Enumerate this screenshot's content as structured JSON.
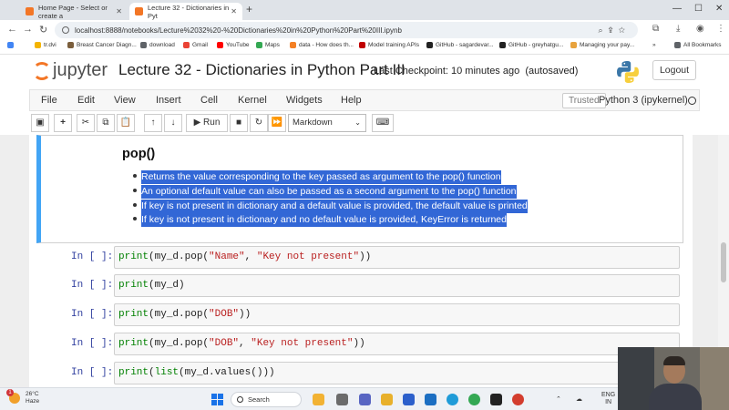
{
  "browser": {
    "tabs": [
      {
        "label": "Home Page - Select or create a",
        "active": false
      },
      {
        "label": "Lecture 32 - Dictionaries in Pyt",
        "active": true
      }
    ],
    "new_tab": "+",
    "url": "localhost:8888/notebooks/Lecture%2032%20-%20Dictionaries%20in%20Python%20Part%20III.ipynb",
    "bookmarks": [
      "tr.dvi",
      "Breast Cancer Diagn...",
      "download",
      "Gmail",
      "YouTube",
      "Maps",
      "data - How does th...",
      "Model training APIs",
      "GitHub - sagardevar...",
      "GitHub - greyhatgu...",
      "Managing your pay...",
      "»",
      "All Bookmarks"
    ]
  },
  "jupyter": {
    "logo_text": "jupyter",
    "notebook_title": "Lecture 32 - Dictionaries in Python Part III",
    "checkpoint_label": "Last Checkpoint:",
    "checkpoint_time": "10 minutes ago",
    "autosave": "(autosaved)",
    "logout": "Logout",
    "menus": [
      "File",
      "Edit",
      "View",
      "Insert",
      "Cell",
      "Kernel",
      "Widgets",
      "Help"
    ],
    "trusted": "Trusted",
    "kernel_name": "Python 3 (ipykernel)",
    "toolbar": {
      "run_label": "Run",
      "cell_type": "Markdown"
    }
  },
  "markdown_cell": {
    "heading": "pop()",
    "items": [
      "Returns the value corresponding to the key passed as argument to the pop() function",
      "An optional default value can also be passed as a second argument to the pop() function",
      "If key is not present in dictionary and a default value is provided, the default value is printed",
      "If key is not present in dictionary and no default value is provided, KeyError is returned"
    ]
  },
  "code_cells": [
    {
      "prompt": "In [ ]:",
      "parts": [
        {
          "t": "print",
          "k": "fn"
        },
        {
          "t": "(my_d.pop(",
          "k": ""
        },
        {
          "t": "\"Name\"",
          "k": "st"
        },
        {
          "t": ", ",
          "k": ""
        },
        {
          "t": "\"Key not present\"",
          "k": "st"
        },
        {
          "t": "))",
          "k": ""
        }
      ]
    },
    {
      "prompt": "In [ ]:",
      "parts": [
        {
          "t": "print",
          "k": "fn"
        },
        {
          "t": "(my_d)",
          "k": ""
        }
      ]
    },
    {
      "prompt": "In [ ]:",
      "parts": [
        {
          "t": "print",
          "k": "fn"
        },
        {
          "t": "(my_d.pop(",
          "k": ""
        },
        {
          "t": "\"DOB\"",
          "k": "st"
        },
        {
          "t": "))",
          "k": ""
        }
      ]
    },
    {
      "prompt": "In [ ]:",
      "parts": [
        {
          "t": "print",
          "k": "fn"
        },
        {
          "t": "(my_d.pop(",
          "k": ""
        },
        {
          "t": "\"DOB\"",
          "k": "st"
        },
        {
          "t": ", ",
          "k": ""
        },
        {
          "t": "\"Key not present\"",
          "k": "st"
        },
        {
          "t": "))",
          "k": ""
        }
      ]
    },
    {
      "prompt": "In [ ]:",
      "parts": [
        {
          "t": "print",
          "k": "fn"
        },
        {
          "t": "(",
          "k": ""
        },
        {
          "t": "list",
          "k": "fn"
        },
        {
          "t": "(my_d.values()))",
          "k": ""
        }
      ]
    }
  ],
  "taskbar": {
    "weather_temp": "26°C",
    "weather_desc": "Haze",
    "notification_count": "1",
    "search": "Search",
    "lang_1": "ENG",
    "lang_2": "IN"
  },
  "colors": {
    "selection": "#3267d6",
    "cell_focus": "#42a5f5",
    "prompt": "#303f9f",
    "string": "#ba2121",
    "builtin": "#008000",
    "jupyter_orange": "#f37626"
  }
}
